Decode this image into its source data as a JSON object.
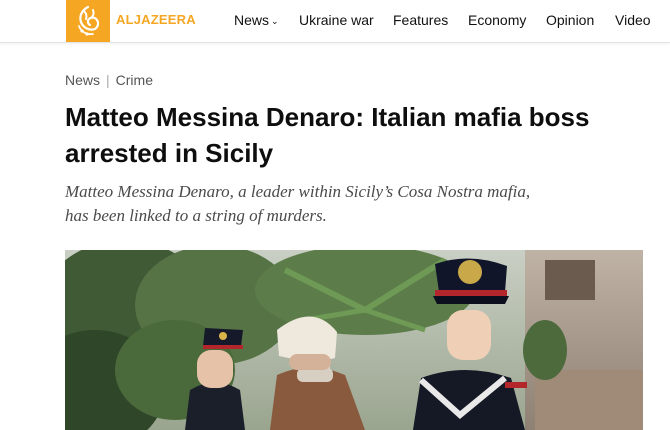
{
  "brand": {
    "logo_text": "ALJAZEERA",
    "color": "#f5a623"
  },
  "nav": {
    "items": [
      {
        "label": "News",
        "has_dropdown": true
      },
      {
        "label": "Ukraine war"
      },
      {
        "label": "Features"
      },
      {
        "label": "Economy"
      },
      {
        "label": "Opinion"
      },
      {
        "label": "Video"
      }
    ]
  },
  "breadcrumb": {
    "section": "News",
    "separator": "|",
    "category": "Crime"
  },
  "article": {
    "headline_line1": "Matteo Messina Denaro: Italian mafia boss",
    "headline_line2": "arrested in Sicily",
    "subhead_line1": "Matteo Messina Denaro, a leader within Sicily’s Cosa Nostra mafia,",
    "subhead_line2": "has been linked to a string of murders."
  },
  "icons": {
    "logo": "aljazeera-logo-icon",
    "dropdown": "chevron-down-icon"
  }
}
